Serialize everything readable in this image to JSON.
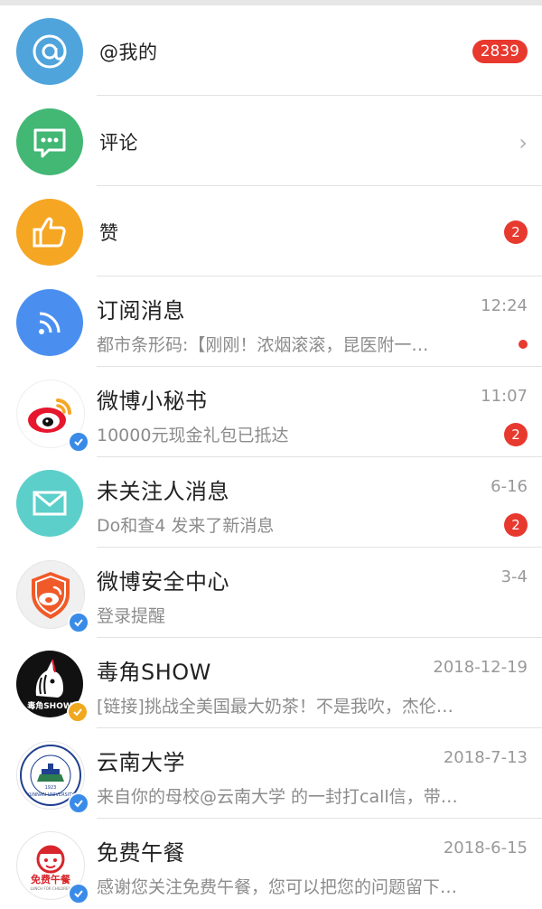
{
  "rows": [
    {
      "title": "@我的",
      "badge": "2839",
      "icon": "at-icon",
      "color": "#4fa4dc"
    },
    {
      "title": "评论",
      "icon": "comment-icon",
      "color": "#43b774"
    },
    {
      "title": "赞",
      "badge": "2",
      "icon": "thumbs-up-icon",
      "color": "#f5a623"
    },
    {
      "title": "订阅消息",
      "time": "12:24",
      "subtitle": "都市条形码:【刚刚！浓烟滚滚，昆医附一…",
      "icon": "rss-icon",
      "color": "#4a8ff0"
    },
    {
      "title": "微博小秘书",
      "time": "11:07",
      "subtitle": "10000元现金礼包已抵达",
      "badge": "2",
      "icon": "weibo-logo-icon"
    },
    {
      "title": "未关注人消息",
      "time": "6-16",
      "subtitle": "Do和查4 发来了新消息",
      "badge": "2",
      "icon": "mail-icon",
      "color": "#5ccfca"
    },
    {
      "title": "微博安全中心",
      "time": "3-4",
      "subtitle": "登录提醒",
      "icon": "shield-weibo-icon"
    },
    {
      "title": "毒角SHOW",
      "time": "2018-12-19",
      "subtitle": "[链接]挑战全美国最大奶茶！不是我吹，杰伦…",
      "icon": "unicorn-logo-icon"
    },
    {
      "title": "云南大学",
      "time": "2018-7-13",
      "subtitle": "来自你的母校@云南大学 的一封打call信，带…",
      "icon": "university-seal-icon"
    },
    {
      "title": "免费午餐",
      "time": "2018-6-15",
      "subtitle": "感谢您关注免费午餐，您可以把您的问题留下…",
      "icon": "free-lunch-logo-icon"
    }
  ],
  "logos": {
    "yunnan_seal": "YUNNAN UNIVERSITY",
    "yunnan_year": "1923",
    "dujiao_text": "毒角SHOW",
    "freelunch_text": "免费午餐",
    "freelunch_sub": "LUNCH FOR CHILDREN"
  },
  "colors": {
    "badge": "#e8392f",
    "verified": "#3a8be8",
    "verified_gold": "#f0a81e"
  }
}
